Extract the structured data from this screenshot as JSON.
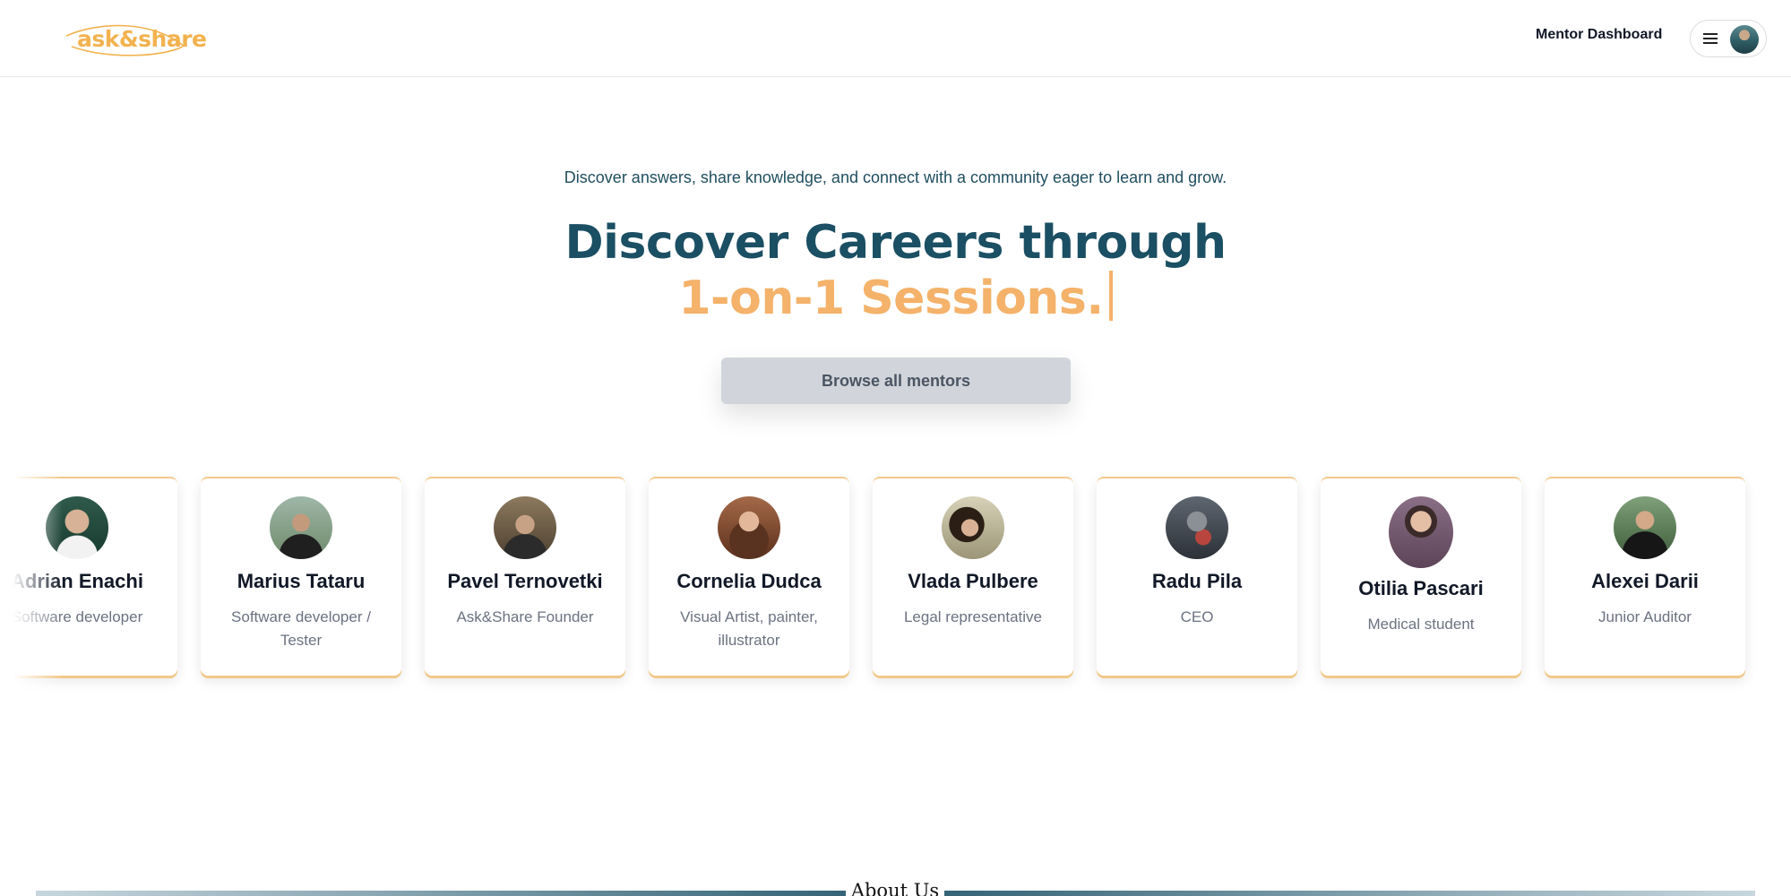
{
  "header": {
    "logo_text": "ask&share",
    "mentor_dashboard_label": "Mentor Dashboard"
  },
  "hero": {
    "tagline": "Discover answers, share knowledge, and connect with a community eager to learn and grow.",
    "title_line1": "Discover Careers through",
    "title_line2": "1-on-1 Sessions.",
    "browse_button": "Browse all mentors"
  },
  "mentors": [
    {
      "name": "Adrian Enachi",
      "role": "Software developer"
    },
    {
      "name": "Marius Tataru",
      "role": "Software developer / Tester"
    },
    {
      "name": "Pavel Ternovetki",
      "role": "Ask&Share Founder"
    },
    {
      "name": "Cornelia Dudca",
      "role": "Visual Artist, painter, illustrator"
    },
    {
      "name": "Vlada Pulbere",
      "role": "Legal representative"
    },
    {
      "name": "Radu Pila",
      "role": "CEO"
    },
    {
      "name": "Otilia Pascari",
      "role": "Medical student"
    },
    {
      "name": "Alexei Darii",
      "role": "Junior Auditor"
    }
  ],
  "about": {
    "label": "About Us"
  },
  "colors": {
    "brand_orange": "#f2b24f",
    "title_teal": "#1b4f63",
    "accent_peach": "#f4b26a",
    "button_gray": "#d1d5db"
  },
  "icons": {
    "menu": "hamburger-menu-icon",
    "user": "user-avatar"
  }
}
